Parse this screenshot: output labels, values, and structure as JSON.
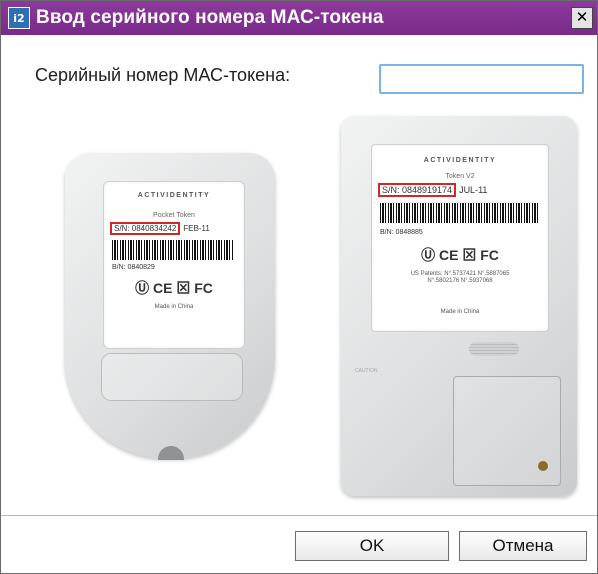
{
  "window": {
    "title": "Ввод серийного номера МАС-токена",
    "icon_text": "i2",
    "close_glyph": "✕"
  },
  "form": {
    "serial_label": "Серийный номер МАС-токена:",
    "serial_value": "",
    "serial_placeholder": ""
  },
  "left_token": {
    "brand": "ACTIVIDENTITY",
    "model": "Pocket Token",
    "sn": "S/N: 0840834242",
    "date": "FEB-11",
    "bn": "B/N: 0840829",
    "marks": "Ⓤ CE ⊠ FC",
    "made_in": "Made in China"
  },
  "right_token": {
    "brand": "ACTIVIDENTITY",
    "model": "Token V2",
    "sn": "S/N: 0848919174",
    "date": "JUL-11",
    "bn": "B/N: 0848885",
    "marks": "Ⓤ CE ⊠ FC",
    "patents": "US Patents:  N°.5737421  N°.5887065  N°.5802176  N°.5937068",
    "made_in": "Made in China",
    "caution": "CAUTION"
  },
  "buttons": {
    "ok": "OK",
    "cancel": "Отмена"
  },
  "colors": {
    "titlebar": "#7a2a8a",
    "input_border": "#7ab4e6",
    "highlight_box": "#d02828"
  }
}
